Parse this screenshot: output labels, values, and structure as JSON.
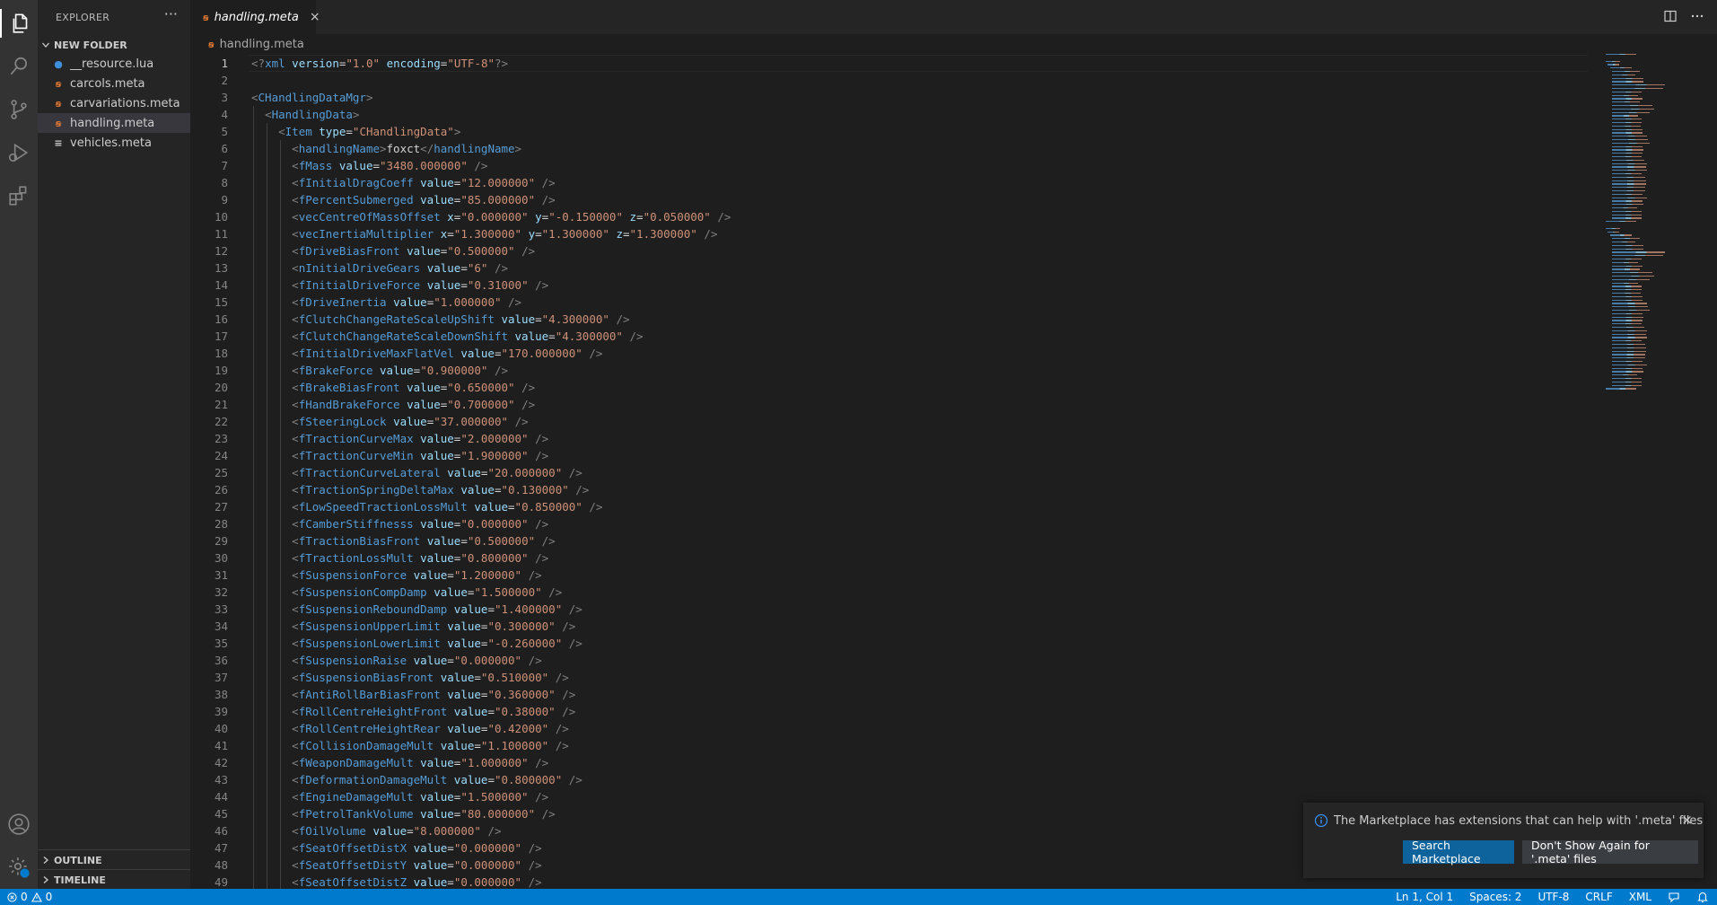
{
  "sidebar": {
    "title": "EXPLORER",
    "more_label": "···",
    "folder": "NEW FOLDER",
    "files": [
      {
        "name": "__resource.lua",
        "icon": "lua-icon"
      },
      {
        "name": "carcols.meta",
        "icon": "rss-icon"
      },
      {
        "name": "carvariations.meta",
        "icon": "rss-icon"
      },
      {
        "name": "handling.meta",
        "icon": "rss-icon",
        "active": true
      },
      {
        "name": "vehicles.meta",
        "icon": "lines-icon"
      }
    ],
    "outline_label": "OUTLINE",
    "timeline_label": "TIMELINE"
  },
  "tab": {
    "title": "handling.meta",
    "close": "×"
  },
  "breadcrumb": {
    "file": "handling.meta"
  },
  "editor": {
    "current_line": 1,
    "lines": [
      "<?xml version=\"1.0\" encoding=\"UTF-8\"?>",
      "",
      "<CHandlingDataMgr>",
      "  <HandlingData>",
      "    <Item type=\"CHandlingData\">",
      "      <handlingName>foxct</handlingName>",
      "      <fMass value=\"3480.000000\" />",
      "      <fInitialDragCoeff value=\"12.000000\" />",
      "      <fPercentSubmerged value=\"85.000000\" />",
      "      <vecCentreOfMassOffset x=\"0.000000\" y=\"-0.150000\" z=\"0.050000\" />",
      "      <vecInertiaMultiplier x=\"1.300000\" y=\"1.300000\" z=\"1.300000\" />",
      "      <fDriveBiasFront value=\"0.500000\" />",
      "      <nInitialDriveGears value=\"6\" />",
      "      <fInitialDriveForce value=\"0.31000\" />",
      "      <fDriveInertia value=\"1.000000\" />",
      "      <fClutchChangeRateScaleUpShift value=\"4.300000\" />",
      "      <fClutchChangeRateScaleDownShift value=\"4.300000\" />",
      "      <fInitialDriveMaxFlatVel value=\"170.000000\" />",
      "      <fBrakeForce value=\"0.900000\" />",
      "      <fBrakeBiasFront value=\"0.650000\" />",
      "      <fHandBrakeForce value=\"0.700000\" />",
      "      <fSteeringLock value=\"37.000000\" />",
      "      <fTractionCurveMax value=\"2.000000\" />",
      "      <fTractionCurveMin value=\"1.900000\" />",
      "      <fTractionCurveLateral value=\"20.000000\" />",
      "      <fTractionSpringDeltaMax value=\"0.130000\" />",
      "      <fLowSpeedTractionLossMult value=\"0.850000\" />",
      "      <fCamberStiffnesss value=\"0.000000\" />",
      "      <fTractionBiasFront value=\"0.500000\" />",
      "      <fTractionLossMult value=\"0.800000\" />",
      "      <fSuspensionForce value=\"1.200000\" />",
      "      <fSuspensionCompDamp value=\"1.500000\" />",
      "      <fSuspensionReboundDamp value=\"1.400000\" />",
      "      <fSuspensionUpperLimit value=\"0.300000\" />",
      "      <fSuspensionLowerLimit value=\"-0.260000\" />",
      "      <fSuspensionRaise value=\"0.000000\" />",
      "      <fSuspensionBiasFront value=\"0.510000\" />",
      "      <fAntiRollBarBiasFront value=\"0.360000\" />",
      "      <fRollCentreHeightFront value=\"0.38000\" />",
      "      <fRollCentreHeightRear value=\"0.42000\" />",
      "      <fCollisionDamageMult value=\"1.100000\" />",
      "      <fWeaponDamageMult value=\"1.000000\" />",
      "      <fDeformationDamageMult value=\"0.800000\" />",
      "      <fEngineDamageMult value=\"1.500000\" />",
      "      <fPetrolTankVolume value=\"80.000000\" />",
      "      <fOilVolume value=\"8.000000\" />",
      "      <fSeatOffsetDistX value=\"0.000000\" />",
      "      <fSeatOffsetDistY value=\"0.000000\" />",
      "      <fSeatOffsetDistZ value=\"0.000000\" />"
    ]
  },
  "notification": {
    "message": "The Marketplace has extensions that can help with '.meta' files",
    "close": "×",
    "primary_button": "Search Marketplace",
    "secondary_button": "Don't Show Again for '.meta' files"
  },
  "statusbar": {
    "errors": "0",
    "warnings": "0",
    "position": "Ln 1, Col 1",
    "spaces": "Spaces: 2",
    "encoding": "UTF-8",
    "eol": "CRLF",
    "language": "XML"
  },
  "colors": {
    "accent": "#007acc",
    "primary_button": "#0e639c",
    "tag": "#569cd6",
    "attribute": "#9cdcfe",
    "string": "#ce9178"
  }
}
